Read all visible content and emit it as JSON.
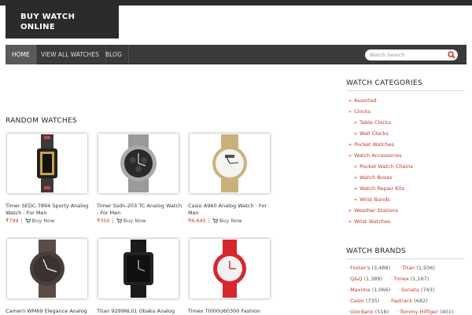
{
  "site": {
    "logo": "BUY WATCH ONLINE",
    "logo_line1": "BUY WATCH",
    "logo_line2": "ONLINE"
  },
  "nav": {
    "items": [
      {
        "label": "HOME",
        "active": true
      },
      {
        "label": "VIEW ALL WATCHES",
        "active": false
      },
      {
        "label": "BLOG",
        "active": false
      }
    ]
  },
  "search": {
    "placeholder": "Watch Search"
  },
  "main": {
    "section_title": "RANDOM WATCHES",
    "products": [
      {
        "title": "Timer SEDC-7894 Sporty Analog Watch - For Men",
        "price": "₹799",
        "buy": "Buy Now",
        "icon": "watch-image"
      },
      {
        "title": "Timer Ssdn-203 TC Analog Watch - For Men",
        "price": "₹350",
        "buy": "Buy Now",
        "icon": "watch-image"
      },
      {
        "title": "Casio A960 Analog Watch - For Men",
        "price": "₹6,645",
        "buy": "Buy Now",
        "icon": "watch-image"
      },
      {
        "title": "Camerii WM69 Elegance Analog",
        "price": "",
        "buy": "",
        "icon": "watch-image"
      },
      {
        "title": "Titan 9299NL01 Obaku Analog",
        "price": "",
        "buy": "",
        "icon": "watch-image"
      },
      {
        "title": "Timex TI000U60300 Fashion",
        "price": "",
        "buy": "",
        "icon": "watch-image"
      }
    ]
  },
  "sidebar": {
    "categories_title": "WATCH CATEGORIES",
    "categories": [
      {
        "label": "Assorted",
        "level": 0
      },
      {
        "label": "Clocks",
        "level": 0
      },
      {
        "label": "Table Clocks",
        "level": 1
      },
      {
        "label": "Wall Clocks",
        "level": 1
      },
      {
        "label": "Pocket Watches",
        "level": 0
      },
      {
        "label": "Watch Accessories",
        "level": 0
      },
      {
        "label": "Pocket Watch Chains",
        "level": 1
      },
      {
        "label": "Watch Boxes",
        "level": 1
      },
      {
        "label": "Watch Repair Kits",
        "level": 1
      },
      {
        "label": "Wrist Bands",
        "level": 1
      },
      {
        "label": "Weather Stations",
        "level": 0
      },
      {
        "label": "Wrist Watches",
        "level": 0
      }
    ],
    "brands_title": "WATCH BRANDS",
    "brands": [
      {
        "name": "Foster's",
        "count": "(3,488)"
      },
      {
        "name": "Titan",
        "count": "(1,936)"
      },
      {
        "name": "Q&Q",
        "count": "(1,389)"
      },
      {
        "name": "Timex",
        "count": "(1,167)"
      },
      {
        "name": "Maxima",
        "count": "(1,066)"
      },
      {
        "name": "Sonata",
        "count": "(743)"
      },
      {
        "name": "Casio",
        "count": "(735)"
      },
      {
        "name": "Fastrack",
        "count": "(682)"
      },
      {
        "name": "Giordano",
        "count": "(518)"
      },
      {
        "name": "Tommy Hilfiger",
        "count": "(401)"
      }
    ]
  },
  "colors": {
    "accent": "#c0392b",
    "nav_bg": "#3a3a3a",
    "header_bg": "#2b2b2b"
  }
}
